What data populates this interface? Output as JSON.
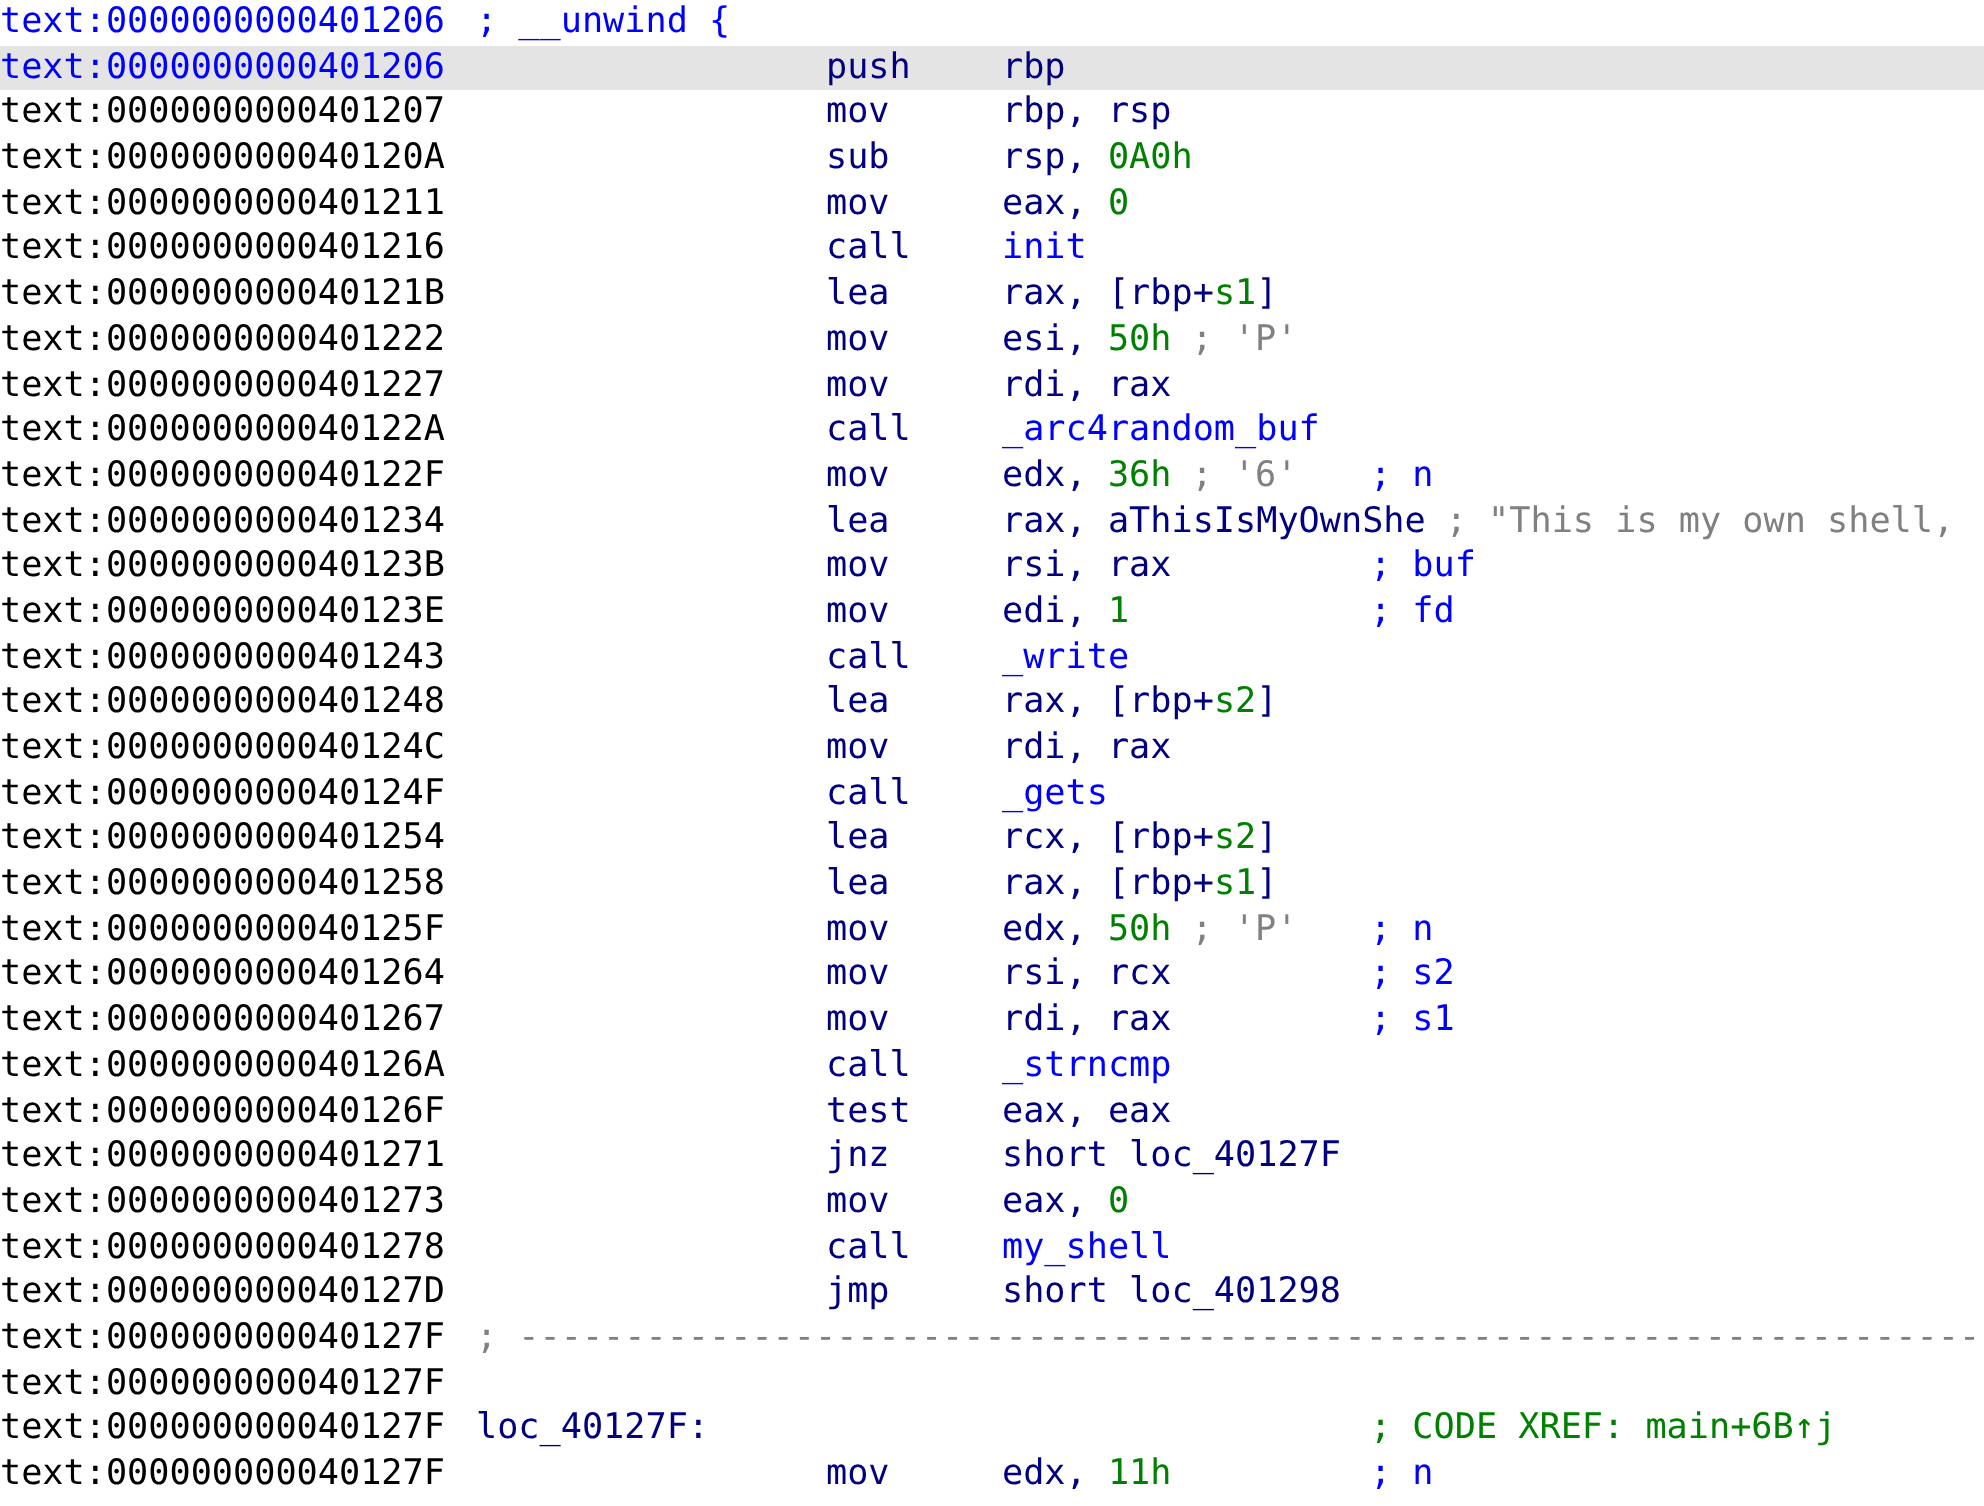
{
  "listing": {
    "rows": [
      {
        "kind": "comment",
        "address": "text:0000000000401206",
        "current": true,
        "selected": false,
        "text": "; __unwind {"
      },
      {
        "kind": "instruction",
        "address": "text:0000000000401206",
        "current": true,
        "selected": true,
        "mnemonic": "push",
        "operands": [
          {
            "text": "rbp",
            "kind": "plain"
          }
        ]
      },
      {
        "kind": "instruction",
        "address": "text:0000000000401207",
        "current": false,
        "selected": false,
        "mnemonic": "mov",
        "operands": [
          {
            "text": "rbp, rsp",
            "kind": "plain"
          }
        ]
      },
      {
        "kind": "instruction",
        "address": "text:000000000040120A",
        "current": false,
        "selected": false,
        "mnemonic": "sub",
        "operands": [
          {
            "text": "rsp, ",
            "kind": "plain"
          },
          {
            "text": "0A0h",
            "kind": "num"
          }
        ]
      },
      {
        "kind": "instruction",
        "address": "text:0000000000401211",
        "current": false,
        "selected": false,
        "mnemonic": "mov",
        "operands": [
          {
            "text": "eax, ",
            "kind": "plain"
          },
          {
            "text": "0",
            "kind": "num"
          }
        ]
      },
      {
        "kind": "instruction",
        "address": "text:0000000000401216",
        "current": false,
        "selected": false,
        "mnemonic": "call",
        "operands": [
          {
            "text": "init",
            "kind": "name"
          }
        ]
      },
      {
        "kind": "instruction",
        "address": "text:000000000040121B",
        "current": false,
        "selected": false,
        "mnemonic": "lea",
        "operands": [
          {
            "text": "rax, [rbp+",
            "kind": "plain"
          },
          {
            "text": "s1",
            "kind": "var"
          },
          {
            "text": "]",
            "kind": "plain"
          }
        ]
      },
      {
        "kind": "instruction",
        "address": "text:0000000000401222",
        "current": false,
        "selected": false,
        "mnemonic": "mov",
        "operands": [
          {
            "text": "esi, ",
            "kind": "plain"
          },
          {
            "text": "50h",
            "kind": "num"
          }
        ],
        "comments": [
          {
            "text": "; 'P'",
            "kind": "auto"
          }
        ]
      },
      {
        "kind": "instruction",
        "address": "text:0000000000401227",
        "current": false,
        "selected": false,
        "mnemonic": "mov",
        "operands": [
          {
            "text": "rdi, rax",
            "kind": "plain"
          }
        ]
      },
      {
        "kind": "instruction",
        "address": "text:000000000040122A",
        "current": false,
        "selected": false,
        "mnemonic": "call",
        "operands": [
          {
            "text": "_arc4random_buf",
            "kind": "name"
          }
        ]
      },
      {
        "kind": "instruction",
        "address": "text:000000000040122F",
        "current": false,
        "selected": false,
        "mnemonic": "mov",
        "operands": [
          {
            "text": "edx, ",
            "kind": "plain"
          },
          {
            "text": "36h",
            "kind": "num"
          }
        ],
        "comments": [
          {
            "text": "; '6'",
            "kind": "auto"
          },
          {
            "text": "; n",
            "kind": "arg"
          }
        ]
      },
      {
        "kind": "instruction",
        "address": "text:0000000000401234",
        "current": false,
        "selected": false,
        "mnemonic": "lea",
        "operands": [
          {
            "text": "rax, aThisIsMyOwnShe",
            "kind": "plain"
          }
        ],
        "comments": [
          {
            "text": "; \"This is my own shell,",
            "kind": "auto"
          }
        ]
      },
      {
        "kind": "instruction",
        "address": "text:000000000040123B",
        "current": false,
        "selected": false,
        "mnemonic": "mov",
        "operands": [
          {
            "text": "rsi, rax",
            "kind": "plain"
          }
        ],
        "comments": [
          {
            "text": "; buf",
            "kind": "arg"
          }
        ]
      },
      {
        "kind": "instruction",
        "address": "text:000000000040123E",
        "current": false,
        "selected": false,
        "mnemonic": "mov",
        "operands": [
          {
            "text": "edi, ",
            "kind": "plain"
          },
          {
            "text": "1",
            "kind": "num"
          }
        ],
        "comments": [
          {
            "text": "; fd",
            "kind": "arg"
          }
        ]
      },
      {
        "kind": "instruction",
        "address": "text:0000000000401243",
        "current": false,
        "selected": false,
        "mnemonic": "call",
        "operands": [
          {
            "text": "_write",
            "kind": "name"
          }
        ]
      },
      {
        "kind": "instruction",
        "address": "text:0000000000401248",
        "current": false,
        "selected": false,
        "mnemonic": "lea",
        "operands": [
          {
            "text": "rax, [rbp+",
            "kind": "plain"
          },
          {
            "text": "s2",
            "kind": "var"
          },
          {
            "text": "]",
            "kind": "plain"
          }
        ]
      },
      {
        "kind": "instruction",
        "address": "text:000000000040124C",
        "current": false,
        "selected": false,
        "mnemonic": "mov",
        "operands": [
          {
            "text": "rdi, rax",
            "kind": "plain"
          }
        ]
      },
      {
        "kind": "instruction",
        "address": "text:000000000040124F",
        "current": false,
        "selected": false,
        "mnemonic": "call",
        "operands": [
          {
            "text": "_gets",
            "kind": "name"
          }
        ]
      },
      {
        "kind": "instruction",
        "address": "text:0000000000401254",
        "current": false,
        "selected": false,
        "mnemonic": "lea",
        "operands": [
          {
            "text": "rcx, [rbp+",
            "kind": "plain"
          },
          {
            "text": "s2",
            "kind": "var"
          },
          {
            "text": "]",
            "kind": "plain"
          }
        ]
      },
      {
        "kind": "instruction",
        "address": "text:0000000000401258",
        "current": false,
        "selected": false,
        "mnemonic": "lea",
        "operands": [
          {
            "text": "rax, [rbp+",
            "kind": "plain"
          },
          {
            "text": "s1",
            "kind": "var"
          },
          {
            "text": "]",
            "kind": "plain"
          }
        ]
      },
      {
        "kind": "instruction",
        "address": "text:000000000040125F",
        "current": false,
        "selected": false,
        "mnemonic": "mov",
        "operands": [
          {
            "text": "edx, ",
            "kind": "plain"
          },
          {
            "text": "50h",
            "kind": "num"
          }
        ],
        "comments": [
          {
            "text": "; 'P'",
            "kind": "auto"
          },
          {
            "text": "; n",
            "kind": "arg"
          }
        ]
      },
      {
        "kind": "instruction",
        "address": "text:0000000000401264",
        "current": false,
        "selected": false,
        "mnemonic": "mov",
        "operands": [
          {
            "text": "rsi, rcx",
            "kind": "plain"
          }
        ],
        "comments": [
          {
            "text": "; s2",
            "kind": "arg"
          }
        ]
      },
      {
        "kind": "instruction",
        "address": "text:0000000000401267",
        "current": false,
        "selected": false,
        "mnemonic": "mov",
        "operands": [
          {
            "text": "rdi, rax",
            "kind": "plain"
          }
        ],
        "comments": [
          {
            "text": "; s1",
            "kind": "arg"
          }
        ]
      },
      {
        "kind": "instruction",
        "address": "text:000000000040126A",
        "current": false,
        "selected": false,
        "mnemonic": "call",
        "operands": [
          {
            "text": "_strncmp",
            "kind": "name"
          }
        ]
      },
      {
        "kind": "instruction",
        "address": "text:000000000040126F",
        "current": false,
        "selected": false,
        "mnemonic": "test",
        "operands": [
          {
            "text": "eax, eax",
            "kind": "plain"
          }
        ]
      },
      {
        "kind": "instruction",
        "address": "text:0000000000401271",
        "current": false,
        "selected": false,
        "mnemonic": "jnz",
        "operands": [
          {
            "text": "short loc_40127F",
            "kind": "plain"
          }
        ]
      },
      {
        "kind": "instruction",
        "address": "text:0000000000401273",
        "current": false,
        "selected": false,
        "mnemonic": "mov",
        "operands": [
          {
            "text": "eax, ",
            "kind": "plain"
          },
          {
            "text": "0",
            "kind": "num"
          }
        ]
      },
      {
        "kind": "instruction",
        "address": "text:0000000000401278",
        "current": false,
        "selected": false,
        "mnemonic": "call",
        "operands": [
          {
            "text": "my_shell",
            "kind": "name"
          }
        ]
      },
      {
        "kind": "instruction",
        "address": "text:000000000040127D",
        "current": false,
        "selected": false,
        "mnemonic": "jmp",
        "operands": [
          {
            "text": "short loc_401298",
            "kind": "plain"
          }
        ]
      },
      {
        "kind": "separator",
        "address": "text:000000000040127F",
        "current": false,
        "selected": false,
        "text": "; ---------------------------------------------------------------------"
      },
      {
        "kind": "blank",
        "address": "text:000000000040127F",
        "current": false,
        "selected": false
      },
      {
        "kind": "label",
        "address": "text:000000000040127F",
        "current": false,
        "selected": false,
        "label": "loc_40127F:",
        "comments": [
          {
            "text": "; CODE XREF: main+6B↑j",
            "kind": "xref"
          }
        ]
      },
      {
        "kind": "instruction",
        "address": "text:000000000040127F",
        "current": false,
        "selected": false,
        "mnemonic": "mov",
        "operands": [
          {
            "text": "edx, ",
            "kind": "plain"
          },
          {
            "text": "11h",
            "kind": "num"
          }
        ],
        "comments": [
          {
            "text": "; n",
            "kind": "arg"
          }
        ]
      }
    ]
  }
}
